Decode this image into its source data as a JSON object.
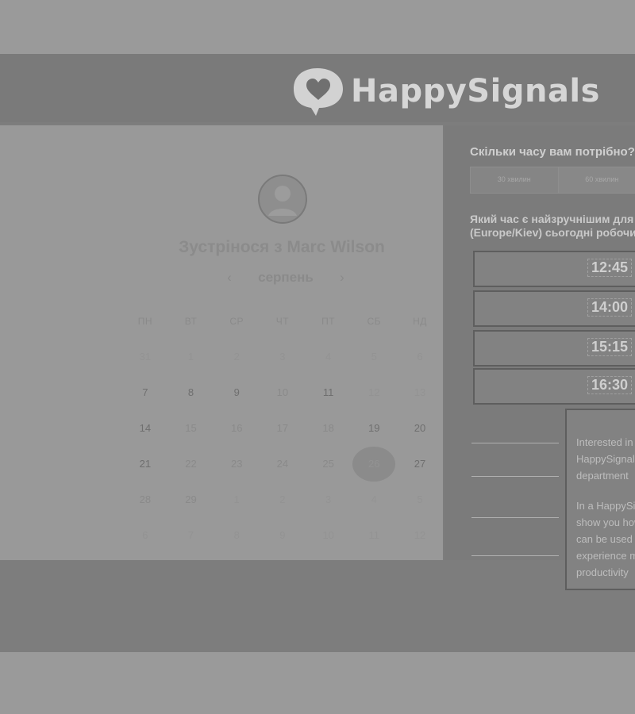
{
  "brand": {
    "name": "HappySignals"
  },
  "calendar": {
    "title": "Зустрінося з Marc Wilson",
    "month": "серпень",
    "prev_icon": "‹",
    "next_icon": "›",
    "weekdays": [
      "ПН",
      "ВТ",
      "СР",
      "ЧТ",
      "ПТ",
      "СБ",
      "НД"
    ],
    "weeks": [
      [
        "31",
        "1",
        "2",
        "3",
        "4",
        "5",
        "6"
      ],
      [
        "7",
        "8",
        "9",
        "10",
        "11",
        "12",
        "13"
      ],
      [
        "14",
        "15",
        "16",
        "17",
        "18",
        "19",
        "20"
      ],
      [
        "21",
        "22",
        "23",
        "24",
        "25",
        "26",
        "27"
      ],
      [
        "28",
        "29",
        "1",
        "2",
        "3",
        "4",
        "5"
      ],
      [
        "6",
        "7",
        "8",
        "9",
        "10",
        "11",
        "12"
      ]
    ],
    "selected_day": "26"
  },
  "side": {
    "duration_question": "Скільки часу вам потрібно?",
    "duration_options": [
      "30 хвилин",
      "60 хвилин"
    ],
    "time_question_line1": "Який час є найзручнішим для",
    "time_question_line2": "(Europe/Kiev) сьогодні робочий",
    "slots": [
      "12:45",
      "14:00",
      "15:15",
      "16:30"
    ],
    "tooltip_line1": "Interested in",
    "tooltip_line2": "HappySignals",
    "tooltip_line3": "department",
    "tooltip_line4": "In a HappySi",
    "tooltip_line5": "show you how",
    "tooltip_line6": "can be used",
    "tooltip_line7": "experience ma",
    "tooltip_line8": "productivity"
  },
  "colors": {
    "brand_accent": "#d6d6d6",
    "selected_day_bg": "#8b8b8b"
  }
}
